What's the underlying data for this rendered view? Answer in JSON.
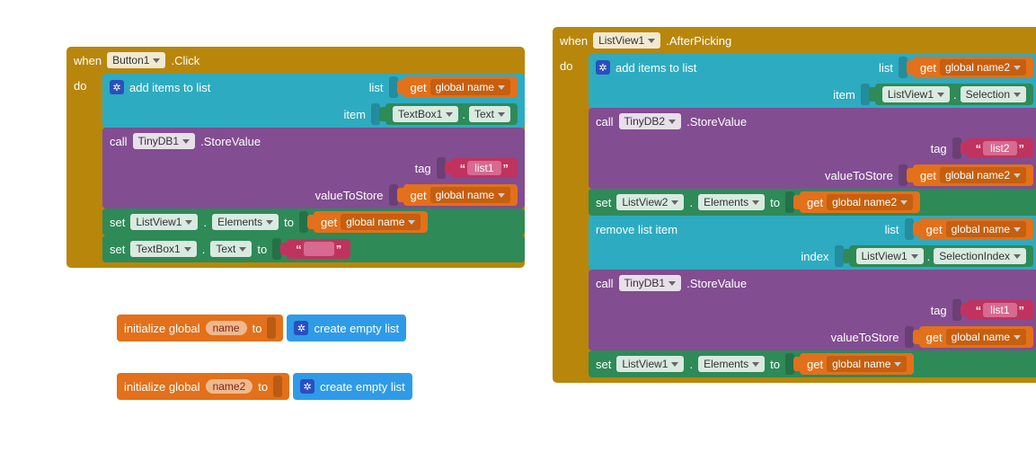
{
  "left": {
    "event": {
      "when": "when",
      "dd": "Button1",
      "suffix": ".Click",
      "do": "do"
    },
    "addItems": {
      "label": "add items to list",
      "listLbl": "list",
      "itemLbl": "item",
      "get": "get",
      "getVar": "global name",
      "itemDd1": "TextBox1",
      "dot": ".",
      "itemDd2": "Text"
    },
    "call1": {
      "call": "call",
      "dd": "TinyDB1",
      "method": ".StoreValue",
      "tag": "tag",
      "tagVal": "list1",
      "val": "valueToStore",
      "get": "get",
      "getVar": "global name"
    },
    "set1": {
      "set": "set",
      "dd1": "ListView1",
      "dot": ".",
      "dd2": "Elements",
      "to": "to",
      "get": "get",
      "getVar": "global name"
    },
    "set2": {
      "set": "set",
      "dd1": "TextBox1",
      "dot": ".",
      "dd2": "Text",
      "to": "to",
      "val": ""
    }
  },
  "init1": {
    "label": "initialize global",
    "name": "name",
    "to": "to",
    "create": "create empty list"
  },
  "init2": {
    "label": "initialize global",
    "name": "name2",
    "to": "to",
    "create": "create empty list"
  },
  "right": {
    "event": {
      "when": "when",
      "dd": "ListView1",
      "suffix": ".AfterPicking",
      "do": "do"
    },
    "addItems": {
      "label": "add items to list",
      "listLbl": "list",
      "itemLbl": "item",
      "get": "get",
      "getVar": "global name2",
      "itemDd1": "ListView1",
      "dot": ".",
      "itemDd2": "Selection"
    },
    "call1": {
      "call": "call",
      "dd": "TinyDB2",
      "method": ".StoreValue",
      "tag": "tag",
      "tagVal": "list2",
      "val": "valueToStore",
      "get": "get",
      "getVar": "global name2"
    },
    "set1": {
      "set": "set",
      "dd1": "ListView2",
      "dot": ".",
      "dd2": "Elements",
      "to": "to",
      "get": "get",
      "getVar": "global name2"
    },
    "remove": {
      "label": "remove list item",
      "listLbl": "list",
      "indexLbl": "index",
      "get": "get",
      "getVar": "global name",
      "idd1": "ListView1",
      "dot": ".",
      "idd2": "SelectionIndex"
    },
    "call2": {
      "call": "call",
      "dd": "TinyDB1",
      "method": ".StoreValue",
      "tag": "tag",
      "tagVal": "list1",
      "val": "valueToStore",
      "get": "get",
      "getVar": "global name"
    },
    "set2": {
      "set": "set",
      "dd1": "ListView1",
      "dot": ".",
      "dd2": "Elements",
      "to": "to",
      "get": "get",
      "getVar": "global name"
    }
  }
}
